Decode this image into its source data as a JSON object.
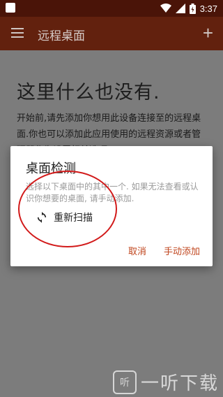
{
  "status_bar": {
    "time": "3:37"
  },
  "app_bar": {
    "title": "远程桌面",
    "add_icon": "plus-icon",
    "menu_icon": "menu-icon"
  },
  "main": {
    "empty_title": "这里什么也没有.",
    "empty_description": "开始前,请先添加你想用此设备连接至的远程桌面.你也可以添加此应用使用的远程资源或者管理器作为设置相关选项."
  },
  "dialog": {
    "title": "桌面检测",
    "message": "选择以下桌面中的其中一个. 如果无法查看或认识你想要的桌面, 请手动添加.",
    "rescan_label": "重新扫描",
    "cancel_label": "取消",
    "manual_add_label": "手动添加"
  },
  "watermark": {
    "text": "一听下载",
    "logo": "听"
  },
  "colors": {
    "accent": "#c0451d",
    "appbar": "#62210e",
    "statusbar": "#4a1408",
    "annotation": "#d21a1a"
  }
}
